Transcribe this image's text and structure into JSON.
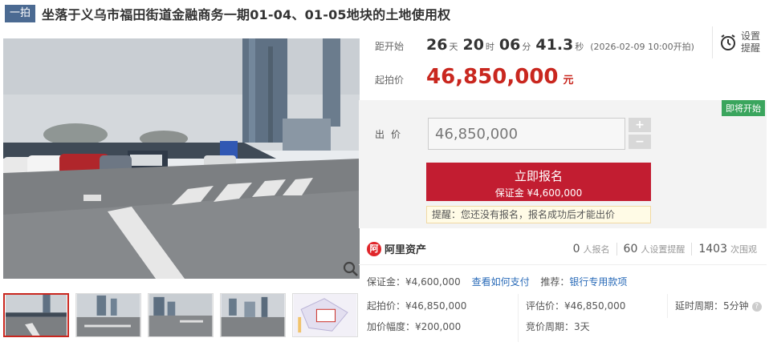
{
  "header": {
    "badge": "一拍",
    "title": "坐落于义乌市福田街道金融商务一期01-04、01-05地块的土地使用权"
  },
  "countdown": {
    "label": "距开始",
    "days": "26",
    "days_unit": "天",
    "hours": "20",
    "hours_unit": "时",
    "minutes": "06",
    "minutes_unit": "分",
    "seconds": "41.3",
    "seconds_unit": "秒",
    "start_note": "(2026-02-09 10:00开拍)"
  },
  "reminder": {
    "line1": "设置",
    "line2": "提醒"
  },
  "starting_price": {
    "label": "起拍价",
    "value": "46,850,000",
    "unit": "元"
  },
  "bid": {
    "status_tag": "即将开始",
    "label": "出价",
    "input_value": "46,850,000",
    "plus": "+",
    "minus": "−",
    "cta_main": "立即报名",
    "cta_sub": "保证金 ¥4,600,000",
    "hint": "提醒：您还没有报名，报名成功后才能出价"
  },
  "platform": {
    "logo_glyph": "阿",
    "name": "阿里资产"
  },
  "stats": [
    {
      "n": "0",
      "label": "人报名"
    },
    {
      "n": "60",
      "label": "人设置提醒"
    },
    {
      "n": "1403",
      "label": "次围观"
    }
  ],
  "details": {
    "deposit_label": "保证金：",
    "deposit_value": "¥4,600,000",
    "pay_link": "查看如何支付",
    "recommend_label": "推荐：",
    "recommend_link": "银行专用款项",
    "start_label": "起拍价：",
    "start_value": "¥46,850,000",
    "eval_label": "评估价：",
    "eval_value": "¥46,850,000",
    "delay_label": "延时周期：",
    "delay_value": "5分钟",
    "increment_label": "加价幅度：",
    "increment_value": "¥200,000",
    "cycle_label": "竞价周期：",
    "cycle_value": "3天"
  },
  "thumbnails": [
    "street-view-1",
    "street-view-2",
    "street-view-3",
    "street-view-4",
    "site-plan-map"
  ],
  "colors": {
    "brand_red": "#c21d31",
    "price_red": "#c9271f",
    "badge_blue": "#4b6a92",
    "status_green": "#3aa55d",
    "link_blue": "#2a6bb8"
  }
}
